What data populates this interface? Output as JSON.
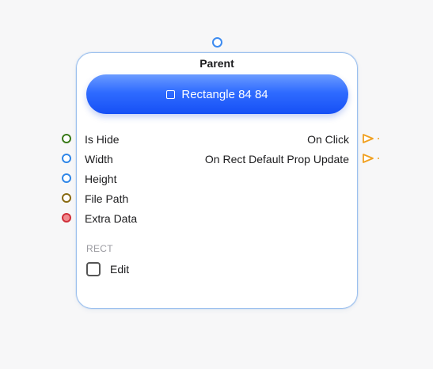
{
  "node": {
    "title": "Parent",
    "main_button": {
      "label": "Rectangle 84 84",
      "icon": "square-icon"
    },
    "inputs": [
      {
        "label": "Is Hide",
        "color": "#3a7a1a",
        "fill": "#ffffff"
      },
      {
        "label": "Width",
        "color": "#2f86e8",
        "fill": "#ffffff"
      },
      {
        "label": "Height",
        "color": "#2f86e8",
        "fill": "#ffffff"
      },
      {
        "label": "File Path",
        "color": "#8a6a10",
        "fill": "#ffffff"
      },
      {
        "label": "Extra Data",
        "color": "#d0303a",
        "fill": "#f08a8e"
      }
    ],
    "outputs": [
      {
        "label": "On Click",
        "color": "#f0a020"
      },
      {
        "label": "On Rect Default Prop Update",
        "color": "#f0a020"
      }
    ],
    "section": {
      "label": "RECT",
      "edit_label": "Edit",
      "edit_checked": false
    }
  },
  "colors": {
    "node_border": "#9cc0ee",
    "button_gradient_top": "#6a9bff",
    "button_gradient_bottom": "#1650f5",
    "top_port": "#3d8bf0"
  }
}
